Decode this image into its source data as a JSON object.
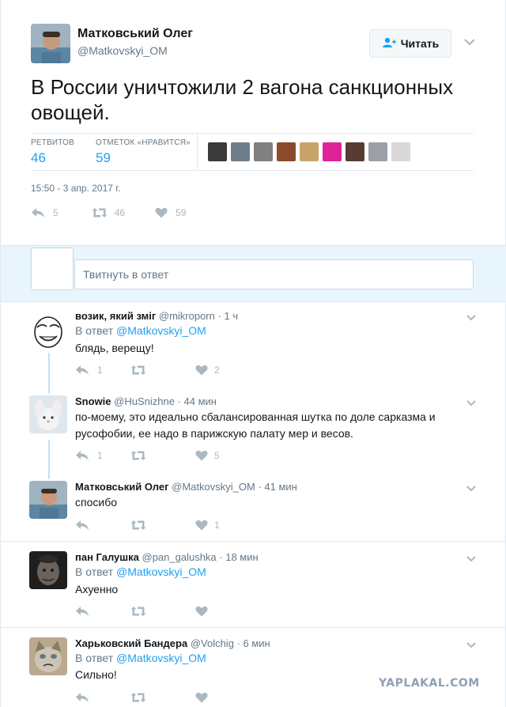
{
  "main_tweet": {
    "author_name": "Матковський Олег",
    "author_handle": "@Matkovskyi_OM",
    "follow_label": "Читать",
    "text": "В России уничтожили 2 вагона санкционных овощей.",
    "retweets_label": "РЕТВИТОВ",
    "retweets_count": "46",
    "likes_label": "ОТМЕТОК «НРАВИТСЯ»",
    "likes_count": "59",
    "timestamp": "15:50 - 3 апр. 2017 г.",
    "action_replies": "5",
    "action_retweets": "46",
    "action_likes": "59",
    "liker_colors": [
      "#3a3a3a",
      "#6f7f8a",
      "#808080",
      "#8b4a2b",
      "#c9a46a",
      "#e0229a",
      "#5a3b34",
      "#9aa0a6",
      "#d8d8d8"
    ]
  },
  "composer": {
    "placeholder": "Твитнуть в ответ"
  },
  "replies": [
    {
      "name": "возик, який зміг",
      "handle": "@mikroporn",
      "time": "· 1 ч",
      "reply_prefix": "В ответ",
      "reply_to": "@Matkovskyi_OM",
      "text": "блядь, верещу!",
      "replies_count": "1",
      "retweets_count": "",
      "likes_count": "2"
    },
    {
      "name": "Snowie",
      "handle": "@HuSnizhne",
      "time": "· 44 мин",
      "text": "по-моему, это идеально сбалансированная шутка по доле сарказма и русофобии, ее надо в парижскую палату мер и весов.",
      "replies_count": "1",
      "retweets_count": "",
      "likes_count": "5"
    },
    {
      "name": "Матковський Олег",
      "handle": "@Matkovskyi_OM",
      "time": "· 41 мин",
      "text": "спосибо",
      "replies_count": "",
      "retweets_count": "",
      "likes_count": "1"
    },
    {
      "name": "пан Галушка",
      "handle": "@pan_galushka",
      "time": "· 18 мин",
      "reply_prefix": "В ответ",
      "reply_to": "@Matkovskyi_OM",
      "text": "Ахуенно",
      "replies_count": "",
      "retweets_count": "",
      "likes_count": ""
    },
    {
      "name": "Харьковский Бандера",
      "handle": "@Volchig",
      "time": "· 6 мин",
      "reply_prefix": "В ответ",
      "reply_to": "@Matkovskyi_OM",
      "text": "Сильно!",
      "replies_count": "",
      "retweets_count": "",
      "likes_count": ""
    }
  ],
  "watermark": "YAPLAKAL.COM",
  "colors": {
    "accent": "#1da1f2",
    "muted": "#657786",
    "icon": "#aab8c2",
    "composer_bg": "#e8f5fd"
  }
}
